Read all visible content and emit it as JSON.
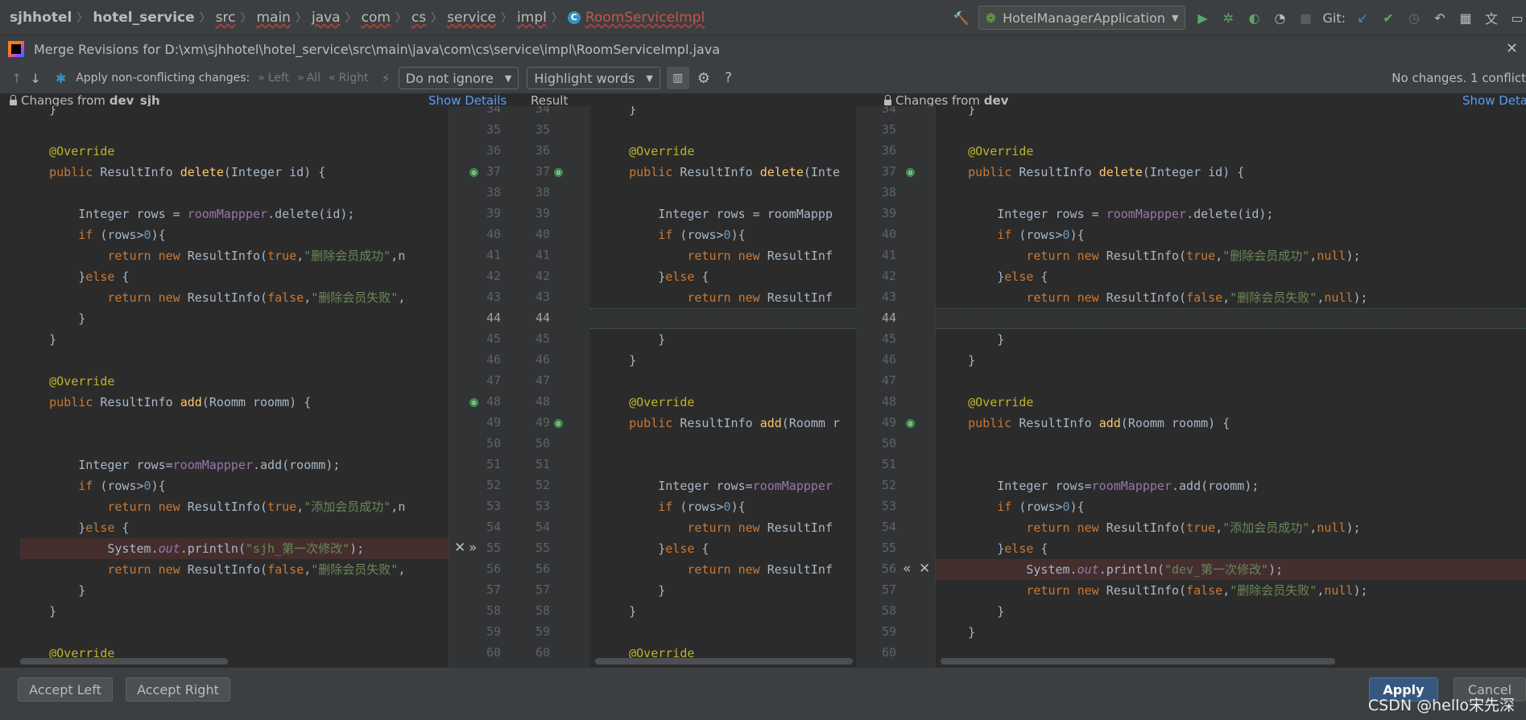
{
  "navbar": {
    "breadcrumbs": [
      "sjhhotel",
      "hotel_service",
      "src",
      "main",
      "java",
      "com",
      "cs",
      "service",
      "impl"
    ],
    "class_name": "RoomServiceImpl",
    "run_config": "HotelManagerApplication",
    "git_label": "Git:"
  },
  "dialog": {
    "title": "Merge Revisions for D:\\xm\\sjhhotel\\hotel_service\\src\\main\\java\\com\\cs\\service\\impl\\RoomServiceImpl.java"
  },
  "toolbar": {
    "apply_non_conflicting": "Apply non-conflicting changes:",
    "left": "Left",
    "all": "All",
    "right": "Right",
    "ignore_combo": "Do not ignore",
    "highlight_combo": "Highlight words",
    "help": "?",
    "status": "No changes. 1 conflict"
  },
  "panels": {
    "left_header_prefix": "Changes from",
    "left_branch": "dev_sjh",
    "show_details": "Show Details",
    "result": "Result",
    "right_header_prefix": "Changes from",
    "right_branch": "dev",
    "show_details_right": "Show Details"
  },
  "line_numbers": [
    "34",
    "35",
    "36",
    "37",
    "38",
    "39",
    "40",
    "41",
    "42",
    "43",
    "44",
    "45",
    "46",
    "47",
    "48",
    "49",
    "50",
    "51",
    "52",
    "53",
    "54",
    "55",
    "56",
    "57",
    "58",
    "59",
    "60"
  ],
  "left_code": [
    "    }",
    "",
    "    @Override",
    "    public ResultInfo delete(Integer id) {",
    "",
    "        Integer rows = roomMappper.delete(id);",
    "        if (rows>0){",
    "            return new ResultInfo(true,\"删除会员成功\",n",
    "        }else {",
    "            return new ResultInfo(false,\"删除会员失败\",",
    "        }",
    "    }",
    "",
    "    @Override",
    "    public ResultInfo add(Roomm roomm) {",
    "",
    "",
    "        Integer rows=roomMappper.add(roomm);",
    "        if (rows>0){",
    "            return new ResultInfo(true,\"添加会员成功\",n",
    "        }else {",
    "            System.out.println(\"sjh_第一次修改\");",
    "            return new ResultInfo(false,\"删除会员失败\",",
    "        }",
    "    }",
    "",
    "    @Override"
  ],
  "middle_code": [
    "    }",
    "",
    "    @Override",
    "    public ResultInfo delete(Inte",
    "",
    "        Integer rows = roomMappp",
    "        if (rows>0){",
    "            return new ResultInf",
    "        }else {",
    "            return new ResultInf",
    "",
    "        }",
    "    }",
    "",
    "    @Override",
    "    public ResultInfo add(Roomm r",
    "",
    "",
    "        Integer rows=roomMappper",
    "        if (rows>0){",
    "            return new ResultInf",
    "        }else {",
    "            return new ResultInf",
    "        }",
    "    }",
    "",
    "    @Override"
  ],
  "right_code": [
    "    }",
    "",
    "    @Override",
    "    public ResultInfo delete(Integer id) {",
    "",
    "        Integer rows = roomMappper.delete(id);",
    "        if (rows>0){",
    "            return new ResultInfo(true,\"删除会员成功\",null);",
    "        }else {",
    "            return new ResultInfo(false,\"删除会员失败\",null);",
    "",
    "        }",
    "    }",
    "",
    "    @Override",
    "    public ResultInfo add(Roomm roomm) {",
    "",
    "",
    "        Integer rows=roomMappper.add(roomm);",
    "        if (rows>0){",
    "            return new ResultInfo(true,\"添加会员成功\",null);",
    "        }else {",
    "            System.out.println(\"dev_第一次修改\");",
    "            return new ResultInfo(false,\"删除会员失败\",null);",
    "        }",
    "    }",
    ""
  ],
  "bottom": {
    "accept_left": "Accept Left",
    "accept_right": "Accept Right",
    "apply": "Apply",
    "cancel": "Cancel",
    "watermark": "CSDN @hello宋先深"
  }
}
